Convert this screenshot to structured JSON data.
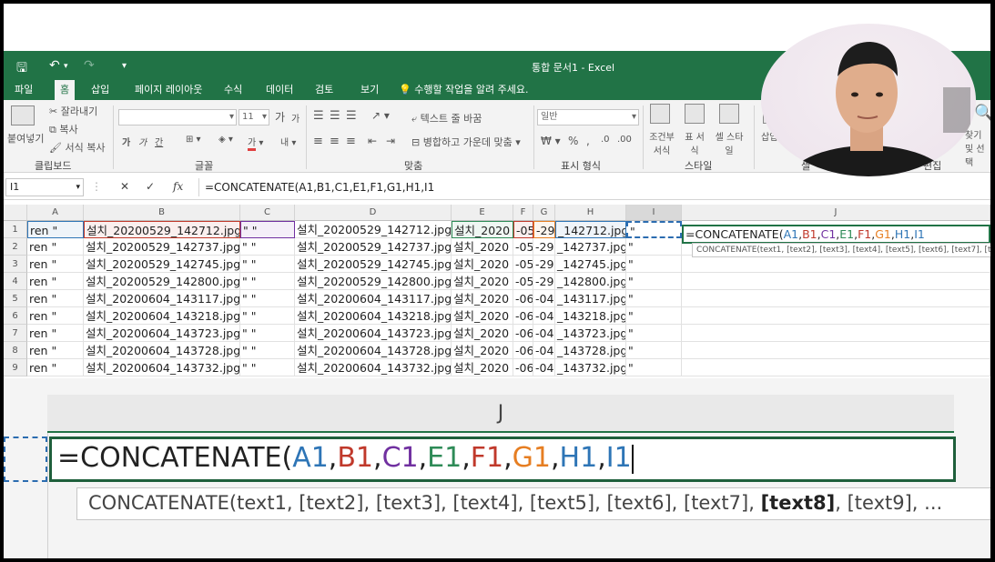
{
  "window": {
    "title": "통합 문서1 - Excel"
  },
  "tabs": [
    "파일",
    "홈",
    "삽입",
    "페이지 레이아웃",
    "수식",
    "데이터",
    "검토",
    "보기"
  ],
  "tell_me": "수행할 작업을 알려 주세요.",
  "ribbon": {
    "clipboard": {
      "paste": "붙여넣기",
      "cut": "잘라내기",
      "copy": "복사",
      "format_painter": "서식 복사",
      "label": "클립보드"
    },
    "font": {
      "size": "11",
      "bold": "가",
      "italic": "가",
      "underline": "간",
      "label": "글꼴",
      "font_grow": "가",
      "font_shrink": "가",
      "font_color": "가",
      "phonetic": "내"
    },
    "alignment": {
      "wrap": "텍스트 줄 바꿈",
      "merge": "병합하고 가운데 맞춤",
      "label": "맞춤"
    },
    "number": {
      "format": "일반",
      "percent": "%",
      "label": "표시 형식"
    },
    "styles": {
      "conditional": "조건부 서식",
      "table": "표 서식",
      "cell": "셀 스타일",
      "label": "스타일"
    },
    "cells": {
      "insert": "삽입",
      "label": "셀"
    },
    "editing": {
      "find": "찾기 및 선택",
      "label": "편집"
    }
  },
  "formula_bar": {
    "name_box": "I1",
    "cancel": "✕",
    "enter": "✓",
    "fx": "fx",
    "formula": "=CONCATENATE(A1,B1,C1,E1,F1,G1,H1,I1"
  },
  "columns": [
    "A",
    "B",
    "C",
    "D",
    "E",
    "F",
    "G",
    "H",
    "I",
    "J"
  ],
  "rows": [
    {
      "n": "1",
      "a": "ren \"",
      "b": "설치_20200529_142712.jpg",
      "c": "\" \"",
      "d": "설치_20200529_142712.jpg",
      "e": "설치_2020",
      "f": "-05",
      "g": "-29",
      "h": "_142712.jpg",
      "i": "\""
    },
    {
      "n": "2",
      "a": "ren \"",
      "b": "설치_20200529_142737.jpg",
      "c": "\" \"",
      "d": "설치_20200529_142737.jpg",
      "e": "설치_2020",
      "f": "-05",
      "g": "-29",
      "h": "_142737.jpg",
      "i": "\""
    },
    {
      "n": "3",
      "a": "ren \"",
      "b": "설치_20200529_142745.jpg",
      "c": "\" \"",
      "d": "설치_20200529_142745.jpg",
      "e": "설치_2020",
      "f": "-05",
      "g": "-29",
      "h": "_142745.jpg",
      "i": "\""
    },
    {
      "n": "4",
      "a": "ren \"",
      "b": "설치_20200529_142800.jpg",
      "c": "\" \"",
      "d": "설치_20200529_142800.jpg",
      "e": "설치_2020",
      "f": "-05",
      "g": "-29",
      "h": "_142800.jpg",
      "i": "\""
    },
    {
      "n": "5",
      "a": "ren \"",
      "b": "설치_20200604_143117.jpg",
      "c": "\" \"",
      "d": "설치_20200604_143117.jpg",
      "e": "설치_2020",
      "f": "-06",
      "g": "-04",
      "h": "_143117.jpg",
      "i": "\""
    },
    {
      "n": "6",
      "a": "ren \"",
      "b": "설치_20200604_143218.jpg",
      "c": "\" \"",
      "d": "설치_20200604_143218.jpg",
      "e": "설치_2020",
      "f": "-06",
      "g": "-04",
      "h": "_143218.jpg",
      "i": "\""
    },
    {
      "n": "7",
      "a": "ren \"",
      "b": "설치_20200604_143723.jpg",
      "c": "\" \"",
      "d": "설치_20200604_143723.jpg",
      "e": "설치_2020",
      "f": "-06",
      "g": "-04",
      "h": "_143723.jpg",
      "i": "\""
    },
    {
      "n": "8",
      "a": "ren \"",
      "b": "설치_20200604_143728.jpg",
      "c": "\" \"",
      "d": "설치_20200604_143728.jpg",
      "e": "설치_2020",
      "f": "-06",
      "g": "-04",
      "h": "_143728.jpg",
      "i": "\""
    },
    {
      "n": "9",
      "a": "ren \"",
      "b": "설치_20200604_143732.jpg",
      "c": "\" \"",
      "d": "설치_20200604_143732.jpg",
      "e": "설치_2020",
      "f": "-06",
      "g": "-04",
      "h": "_143732.jpg",
      "i": "\""
    }
  ],
  "edit_formula": {
    "prefix": "=CONCATENATE(",
    "refs": [
      {
        "t": "A1",
        "color": "#2e75b6"
      },
      {
        "t": "B1",
        "color": "#c0392b"
      },
      {
        "t": "C1",
        "color": "#7030a0"
      },
      {
        "t": "E1",
        "color": "#2e8b57"
      },
      {
        "t": "F1",
        "color": "#c0392b"
      },
      {
        "t": "G1",
        "color": "#e67e22"
      },
      {
        "t": "H1",
        "color": "#2e75b6"
      },
      {
        "t": "I1",
        "color": "#2e75b6"
      }
    ]
  },
  "tooltip_small": "CONCATENATE(text1, [text2], [text3], [text4], [text5], [text6], [text7], [t",
  "zoom": {
    "column": "J",
    "tooltip_parts": [
      {
        "t": "CONCATENATE(text1, [text2], [text3], [text4], [text5], [text6], [text7], ",
        "bold": false
      },
      {
        "t": "[text8]",
        "bold": true
      },
      {
        "t": ", [text9], ...",
        "bold": false
      }
    ]
  },
  "colors": {
    "excel_green": "#217346",
    "selection": "#217346"
  }
}
